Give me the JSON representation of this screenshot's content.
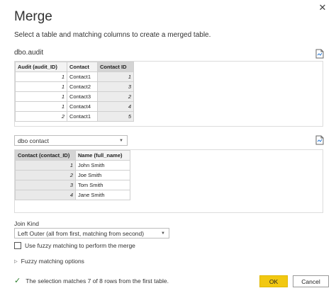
{
  "dialog": {
    "title": "Merge",
    "subtitle": "Select a table and matching columns to create a merged table.",
    "close_icon": "close-icon"
  },
  "top_table": {
    "name": "dbo.audit",
    "headers": [
      "Audit (audit_ID)",
      "Contact",
      "Contact ID"
    ],
    "rows": [
      [
        "1",
        "Contact1",
        "1"
      ],
      [
        "1",
        "Contact2",
        "3"
      ],
      [
        "1",
        "Contact3",
        "2"
      ],
      [
        "1",
        "Contact4",
        "4"
      ],
      [
        "2",
        "Contact1",
        "5"
      ]
    ],
    "selected_column": "Contact ID"
  },
  "bottom_table": {
    "selected_table": "dbo contact",
    "headers": [
      "Contact (contact_ID)",
      "Name (full_name)"
    ],
    "rows": [
      [
        "1",
        "John Smith"
      ],
      [
        "2",
        "Joe Smith"
      ],
      [
        "3",
        "Tom Smith"
      ],
      [
        "4",
        "Jane Smith"
      ]
    ],
    "selected_column": "Contact (contact_ID)"
  },
  "join": {
    "label": "Join Kind",
    "selected": "Left Outer (all from first, matching from second)"
  },
  "fuzzy": {
    "checkbox_label": "Use fuzzy matching to perform the merge",
    "checked": false,
    "options_label": "Fuzzy matching options"
  },
  "status": {
    "text": "The selection matches 7 of 8 rows from the first table."
  },
  "buttons": {
    "ok": "OK",
    "cancel": "Cancel"
  }
}
